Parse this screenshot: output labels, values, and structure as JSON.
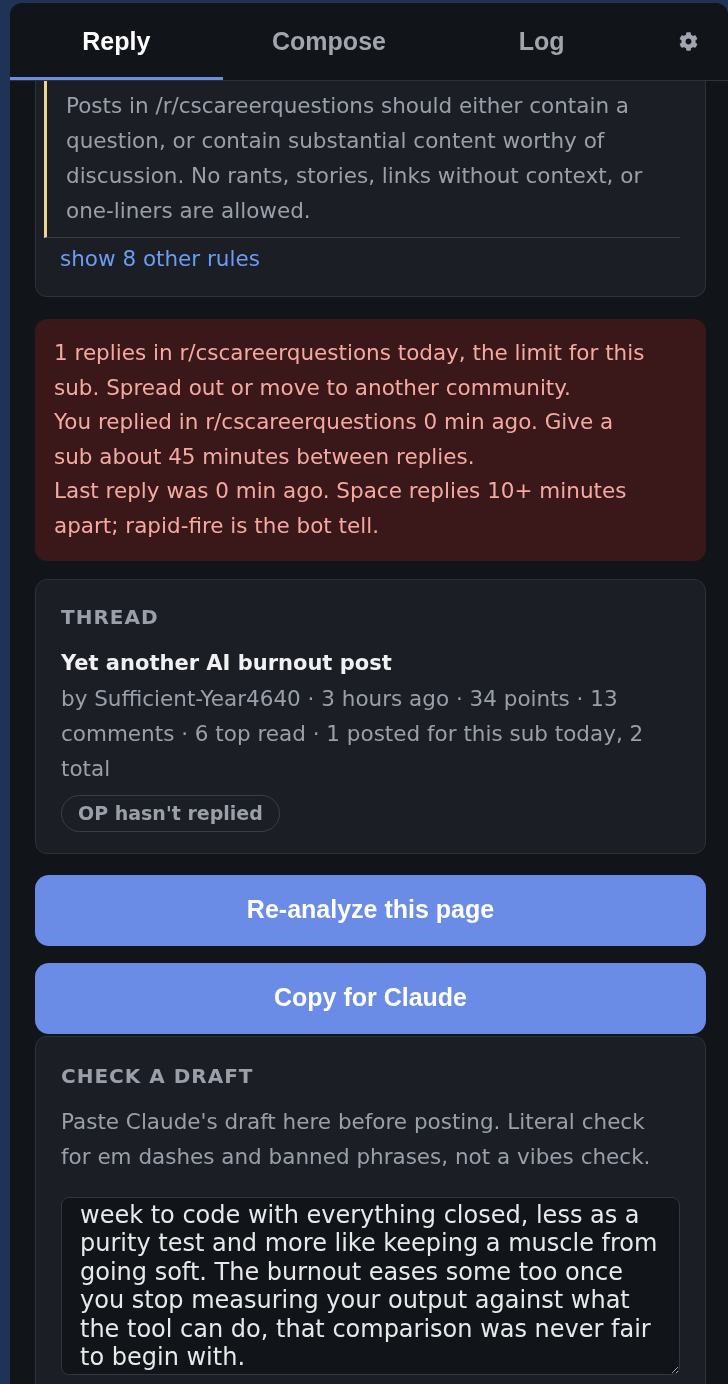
{
  "tabs": [
    {
      "label": "Reply",
      "selected": true
    },
    {
      "label": "Compose",
      "selected": false
    },
    {
      "label": "Log",
      "selected": false
    }
  ],
  "rules_card": {
    "rule_text": "Posts in /r/cscareerquestions should either contain a question, or contain substantial content worthy of discussion. No rants, stories, links without context, or one-liners are allowed.",
    "link": "show 8 other rules"
  },
  "warnings": [
    "1 replies in r/cscareerquestions today, the limit for this sub. Spread out or move to another community.",
    "You replied in r/cscareerquestions 0 min ago. Give a sub about 45 minutes between replies.",
    "Last reply was 0 min ago. Space replies 10+ minutes apart; rapid-fire is the bot tell."
  ],
  "thread": {
    "heading": "THREAD",
    "title": "Yet another AI burnout post",
    "meta": "by Sufficient-Year4640 · 3 hours ago · 34 points · 13 comments · 6 top read · 1 posted for this sub today, 2 total",
    "badge": "OP hasn't replied"
  },
  "buttons": [
    "Re-analyze this page",
    "Copy for Claude"
  ],
  "check_draft": {
    "heading": "CHECK A DRAFT",
    "description": "Paste Claude's draft here before posting. Literal check for em dashes and banned phrases, not a vibes check.",
    "draft": "week to code with everything closed, less as a purity test and more like keeping a muscle from going soft. The burnout eases some too once you stop measuring your output against what the tool can do, that comparison was never fair to begin with."
  }
}
